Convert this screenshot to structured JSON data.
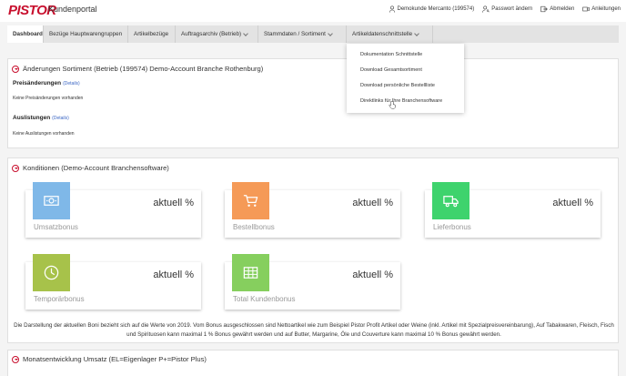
{
  "header": {
    "logo": "PISTOR",
    "portal_title": "Kundenportal",
    "customer": "Demokunde Mercanto (199574)",
    "password": "Passwort ändern",
    "logout": "Abmelden",
    "guides": "Anleitungen"
  },
  "nav": {
    "tabs": [
      {
        "label": "Dashboard"
      },
      {
        "label": "Bezüge Hauptwarengruppen"
      },
      {
        "label": "Artikelbezüge"
      },
      {
        "label": "Auftragsarchiv (Betrieb)"
      },
      {
        "label": "Stammdaten / Sortiment"
      },
      {
        "label": "Artikeldatenschnittstelle"
      }
    ]
  },
  "dropdown": {
    "items": [
      {
        "label": "Dokumentation Schnittstelle"
      },
      {
        "label": "Download Gesamtsortiment"
      },
      {
        "label": "Download persönliche Bestellliste"
      },
      {
        "label": "Direktlinks für Ihre Branchensoftware"
      }
    ]
  },
  "changes_panel": {
    "title": "Änderungen Sortiment (Betrieb (199574) Demo-Account Branche Rothenburg)",
    "price_title": "Preisänderungen",
    "price_details": "(Details)",
    "price_text": "Keine Preisänderungen vorhanden",
    "delist_title": "Auslistungen",
    "delist_details": "(Details)",
    "delist_text": "Keine Auslistungen vorhanden"
  },
  "conditions_panel": {
    "title": "Konditionen (Demo-Account Branchensoftware)",
    "cards": [
      {
        "label": "Umsatzbonus",
        "value": "aktuell %",
        "color": "#7fb8e8",
        "icon": "money-icon"
      },
      {
        "label": "Bestellbonus",
        "value": "aktuell %",
        "color": "#f59a57",
        "icon": "cart-icon"
      },
      {
        "label": "Lieferbonus",
        "value": "aktuell %",
        "color": "#3ed36d",
        "icon": "truck-icon"
      },
      {
        "label": "Temporärbonus",
        "value": "aktuell %",
        "color": "#a7c24a",
        "icon": "clock-icon"
      },
      {
        "label": "Total Kundenbonus",
        "value": "aktuell %",
        "color": "#86cf5e",
        "icon": "table-icon"
      }
    ],
    "note": "Die Darstellung der aktuellen Boni bezieht sich auf die Werte von 2019. Vom Bonus ausgeschlossen sind Nettoartikel wie zum Beispiel Pistor Profit Artikel oder Weine (inkl. Artikel mit Spezialpreisvereinbarung), Auf Tabakwaren, Fleisch, Fisch und Spirituosen kann maximal 1 % Bonus gewährt werden und auf Butter, Margarine, Öle und Couverture kann maximal 10 % Bonus gewährt werden."
  },
  "monthly_panel": {
    "title": "Monatsentwicklung Umsatz (EL=Eigenlager P+=Pistor Plus)"
  }
}
